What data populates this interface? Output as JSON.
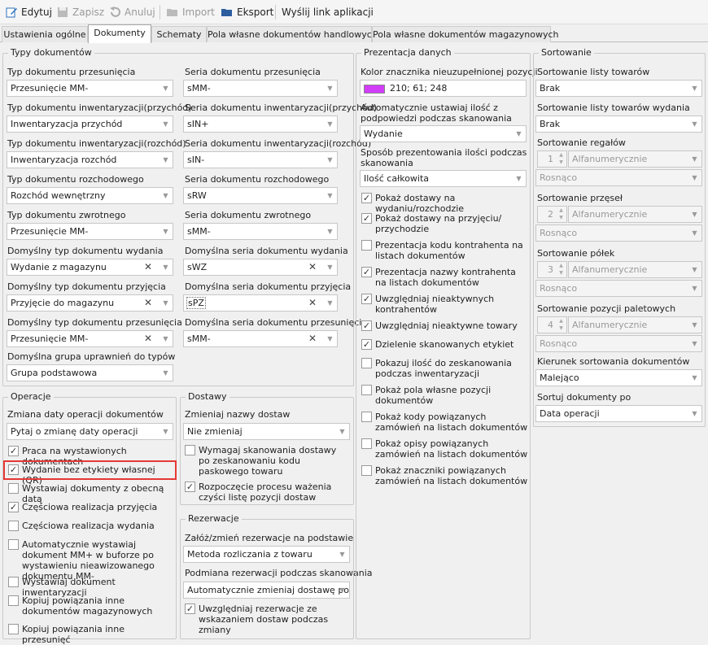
{
  "toolbar": {
    "edit": "Edytuj",
    "save": "Zapisz",
    "cancel": "Anuluj",
    "import": "Import",
    "export": "Eksport",
    "send_link": "Wyślij link aplikacji"
  },
  "tabs": [
    "Ustawienia ogólne",
    "Dokumenty",
    "Schematy",
    "Pola własne dokumentów handlowych",
    "Pola własne dokumentów magazynowych"
  ],
  "doc_types": {
    "title": "Typy dokumentów",
    "rows": [
      {
        "l_label": "Typ dokumentu przesunięcia",
        "l_value": "Przesunięcie MM-",
        "r_label": "Seria dokumentu przesunięcia",
        "r_value": "sMM-"
      },
      {
        "l_label": "Typ dokumentu inwentaryzacji(przychód)",
        "l_value": "Inwentaryzacja przychód",
        "r_label": "Seria dokumentu inwentaryzacji(przychód)",
        "r_value": "sIN+"
      },
      {
        "l_label": "Typ dokumentu inwentaryzacji(rozchód)",
        "l_value": "Inwentaryzacja rozchód",
        "r_label": "Seria dokumentu inwentaryzacji(rozchód)",
        "r_value": "sIN-"
      },
      {
        "l_label": "Typ dokumentu rozchodowego",
        "l_value": "Rozchód wewnętrzny",
        "r_label": "Seria dokumentu rozchodowego",
        "r_value": "sRW"
      },
      {
        "l_label": "Typ dokumentu zwrotnego",
        "l_value": "Przesunięcie MM-",
        "r_label": "Seria dokumentu zwrotnego",
        "r_value": "sMM-"
      },
      {
        "l_label": "Domyślny typ dokumentu wydania",
        "l_value": "Wydanie z magazynu",
        "r_label": "Domyślna seria dokumentu wydania",
        "r_value": "sWZ"
      },
      {
        "l_label": "Domyślny typ dokumentu przyjęcia",
        "l_value": "Przyjęcie do magazynu",
        "r_label": "Domyślna seria dokumentu przyjęcia",
        "r_value": "sPZ"
      },
      {
        "l_label": "Domyślny typ dokumentu przesunięcia",
        "l_value": "Przesunięcie MM-",
        "r_label": "Domyślna seria dokumentu przesunięcia",
        "r_value": "sMM-"
      }
    ],
    "group_label": "Domyślna grupa uprawnień do typów",
    "group_value": "Grupa podstawowa"
  },
  "operations": {
    "title": "Operacje",
    "date_label": "Zmiana daty operacji dokumentów",
    "date_value": "Pytaj o zmianę daty operacji",
    "checks": [
      {
        "label": "Praca na wystawionych dokumentach",
        "checked": true
      },
      {
        "label": "Wydanie bez etykiety własnej (QR)",
        "checked": true
      },
      {
        "label": "Wystawiaj dokumenty z obecną datą",
        "checked": false
      },
      {
        "label": "Częściowa realizacja przyjęcia",
        "checked": true
      },
      {
        "label": "Częściowa realizacja wydania",
        "checked": false
      },
      {
        "label": "Automatycznie wystawiaj dokument MM+ w buforze po wystawieniu nieawizowanego dokumentu MM-",
        "checked": false
      },
      {
        "label": "Wystawiaj dokument inwentaryzacji",
        "checked": false
      },
      {
        "label": "Kopiuj powiązania inne dokumentów magazynowych",
        "checked": false
      },
      {
        "label": "Kopiuj powiązania inne przesunięć",
        "checked": false
      }
    ]
  },
  "deliveries": {
    "title": "Dostawy",
    "name_label": "Zmieniaj nazwy dostaw",
    "name_value": "Nie zmieniaj",
    "checks": [
      {
        "label": "Wymagaj skanowania dostawy po zeskanowaniu kodu paskowego towaru",
        "checked": false
      },
      {
        "label": "Rozpoczęcie procesu ważenia czyści listę pozycji dostaw",
        "checked": true
      }
    ]
  },
  "reservations": {
    "title": "Rezerwacje",
    "create_label": "Załóż/zmień rezerwacje na podstawie",
    "create_value": "Metoda rozliczania z towaru",
    "replace_label": "Podmiana rezerwacji podczas skanowania",
    "replace_value": "Automatycznie zmieniaj dostawę po...",
    "checks": [
      {
        "label": "Uwzględniaj rezerwacje ze wskazaniem dostaw podczas zmiany",
        "checked": true
      }
    ]
  },
  "presentation": {
    "title": "Prezentacja danych",
    "color_label": "Kolor znacznika nieuzupełnionej pozycji",
    "color_value": "210; 61; 248",
    "color_hex": "#d23df8",
    "qty_label": "Automatycznie ustawiaj ilość z podpowiedzi podczas skanowania",
    "qty_value": "Wydanie",
    "show_label": "Sposób prezentowania ilości podczas skanowania",
    "show_value": "Ilość całkowita",
    "checks": [
      {
        "label": "Pokaż dostawy na wydaniu/rozchodzie",
        "checked": true
      },
      {
        "label": "Pokaż dostawy na przyjęciu/ przychodzie",
        "checked": true
      },
      {
        "label": "Prezentacja kodu kontrahenta na listach dokumentów",
        "checked": false
      },
      {
        "label": "Prezentacja nazwy kontrahenta na listach dokumentów",
        "checked": true
      },
      {
        "label": "Uwzględniaj nieaktywnych kontrahentów",
        "checked": true
      },
      {
        "label": "Uwzględniaj nieaktywne towary",
        "checked": true
      },
      {
        "label": "Dzielenie skanowanych etykiet",
        "checked": true
      },
      {
        "label": "Pokazuj ilość do zeskanowania podczas inwentaryzacji",
        "checked": false
      },
      {
        "label": "Pokaż pola własne pozycji dokumentów",
        "checked": false
      },
      {
        "label": "Pokaż kody powiązanych zamówień na listach dokumentów",
        "checked": false
      },
      {
        "label": "Pokaż opisy powiązanych zamówień na listach dokumentów",
        "checked": false
      },
      {
        "label": "Pokaż znaczniki powiązanych zamówień na listach dokumentów",
        "checked": false
      }
    ]
  },
  "sorting": {
    "title": "Sortowanie",
    "items_label": "Sortowanie listy towarów",
    "items_value": "Brak",
    "release_label": "Sortowanie listy towarów wydania",
    "release_value": "Brak",
    "groups": [
      {
        "label": "Sortowanie regałów",
        "num": "1",
        "field": "Alfanumerycznie",
        "order": "Rosnąco"
      },
      {
        "label": "Sortowanie przęseł",
        "num": "2",
        "field": "Alfanumerycznie",
        "order": "Rosnąco"
      },
      {
        "label": "Sortowanie półek",
        "num": "3",
        "field": "Alfanumerycznie",
        "order": "Rosnąco"
      },
      {
        "label": "Sortowanie pozycji paletowych",
        "num": "4",
        "field": "Alfanumerycznie",
        "order": "Rosnąco"
      }
    ],
    "direction_label": "Kierunek sortowania dokumentów",
    "direction_value": "Malejąco",
    "sortby_label": "Sortuj dokumenty po",
    "sortby_value": "Data operacji"
  }
}
